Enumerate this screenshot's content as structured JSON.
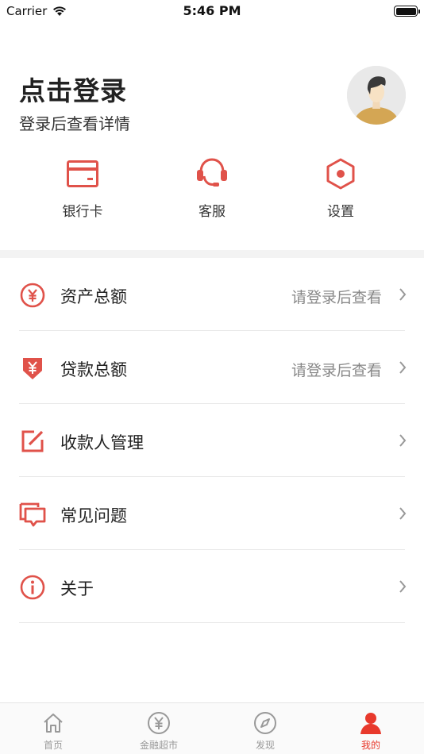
{
  "status_bar": {
    "carrier": "Carrier",
    "time": "5:46 PM"
  },
  "header": {
    "title": "点击登录",
    "subtitle": "登录后查看详情"
  },
  "quick_actions": [
    {
      "label": "银行卡",
      "icon": "bank-card-icon"
    },
    {
      "label": "客服",
      "icon": "headset-icon"
    },
    {
      "label": "设置",
      "icon": "settings-hexagon-icon"
    }
  ],
  "menu": [
    {
      "label": "资产总额",
      "value": "请登录后查看",
      "icon": "yen-circle-icon"
    },
    {
      "label": "贷款总额",
      "value": "请登录后查看",
      "icon": "yen-tag-icon"
    },
    {
      "label": "收款人管理",
      "value": "",
      "icon": "edit-icon"
    },
    {
      "label": "常见问题",
      "value": "",
      "icon": "chat-bubbles-icon"
    },
    {
      "label": "关于",
      "value": "",
      "icon": "info-icon"
    }
  ],
  "tabbar": [
    {
      "label": "首页",
      "icon": "home-icon",
      "active": false
    },
    {
      "label": "金融超市",
      "icon": "yen-coin-icon",
      "active": false
    },
    {
      "label": "发现",
      "icon": "compass-icon",
      "active": false
    },
    {
      "label": "我的",
      "icon": "person-icon",
      "active": true
    }
  ],
  "colors": {
    "accent": "#e8392c",
    "icon_red": "#e0524a",
    "inactive": "#999999"
  }
}
